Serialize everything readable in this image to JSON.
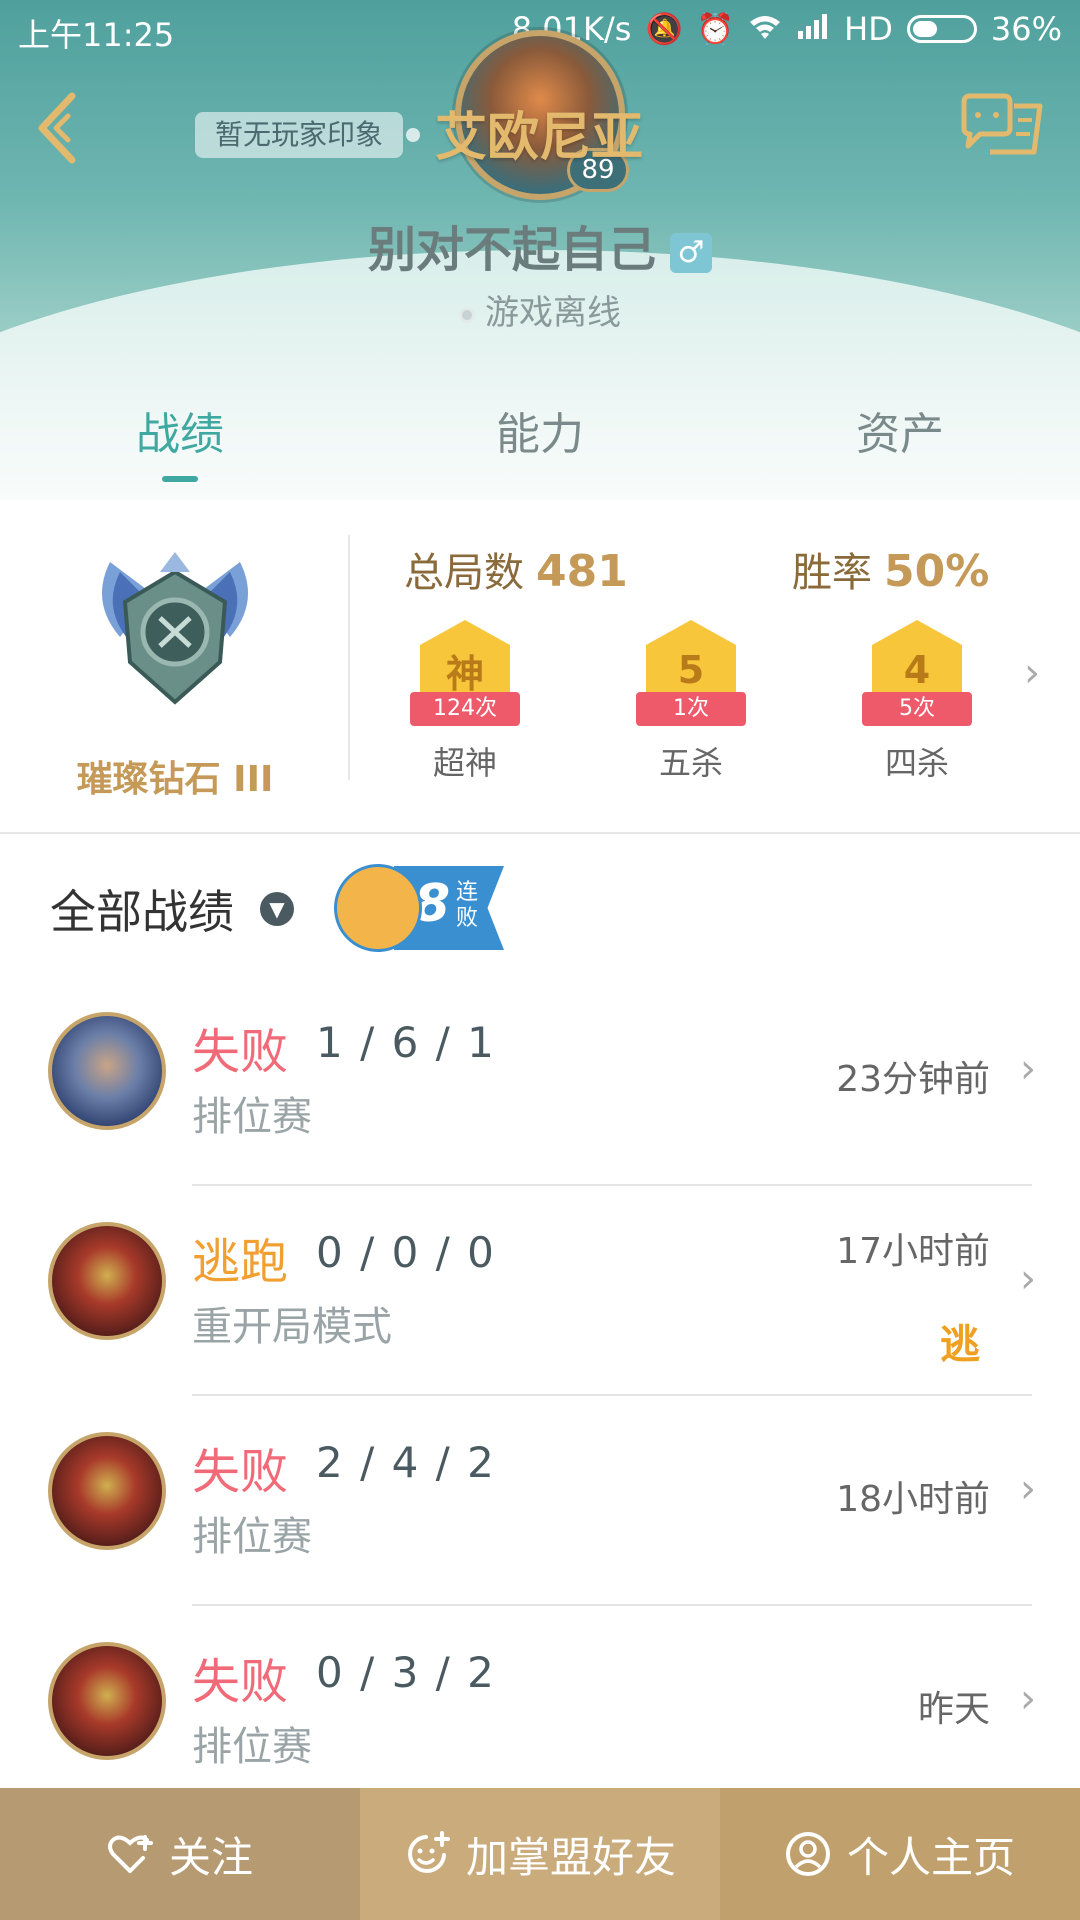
{
  "status_bar": {
    "time": "上午11:25",
    "network_speed": "8.01K/s",
    "hd_label": "HD",
    "battery": "36%"
  },
  "header": {
    "impression": "暂无玩家印象",
    "server": "艾欧尼亚",
    "level": "89",
    "nickname": "别对不起自己",
    "gender_symbol": "♂",
    "status": "游戏离线",
    "back_icon": "back-chevron-icon",
    "chat_icon": "chat-icon"
  },
  "tabs": [
    {
      "label": "战绩",
      "active": true
    },
    {
      "label": "能力",
      "active": false
    },
    {
      "label": "资产",
      "active": false
    }
  ],
  "stats": {
    "rank": "璀璨钻石 III",
    "total_label": "总局数",
    "total_value": "481",
    "winrate_label": "胜率",
    "winrate_value": "50%",
    "badges": [
      {
        "glyph": "神",
        "count": "124次",
        "label": "超神"
      },
      {
        "glyph": "5",
        "count": "1次",
        "label": "五杀"
      },
      {
        "glyph": "4",
        "count": "5次",
        "label": "四杀"
      }
    ]
  },
  "filter": {
    "label": "全部战绩",
    "streak_number": "8",
    "streak_text": "连败"
  },
  "matches": [
    {
      "result": "失败",
      "result_color": "#f06a78",
      "kda": "1 / 6 / 1",
      "mode": "排位赛",
      "time": "23分钟前",
      "hero": "blue"
    },
    {
      "result": "逃跑",
      "result_color": "#f0a030",
      "kda": "0 / 0 / 0",
      "mode": "重开局模式",
      "time": "17小时前",
      "hero": "red",
      "escape_glyph": "逃"
    },
    {
      "result": "失败",
      "result_color": "#f06a78",
      "kda": "2 / 4 / 2",
      "mode": "排位赛",
      "time": "18小时前",
      "hero": "red"
    },
    {
      "result": "失败",
      "result_color": "#f06a78",
      "kda": "0 / 3 / 2",
      "mode": "排位赛",
      "time": "昨天",
      "hero": "red"
    }
  ],
  "bottom_bar": [
    {
      "label": "关注",
      "icon": "heart-plus-icon",
      "color": "#b59a72"
    },
    {
      "label": "加掌盟好友",
      "icon": "smile-plus-icon",
      "color": "#c9ab7c"
    },
    {
      "label": "个人主页",
      "icon": "person-icon",
      "color": "#c0a06c"
    }
  ]
}
